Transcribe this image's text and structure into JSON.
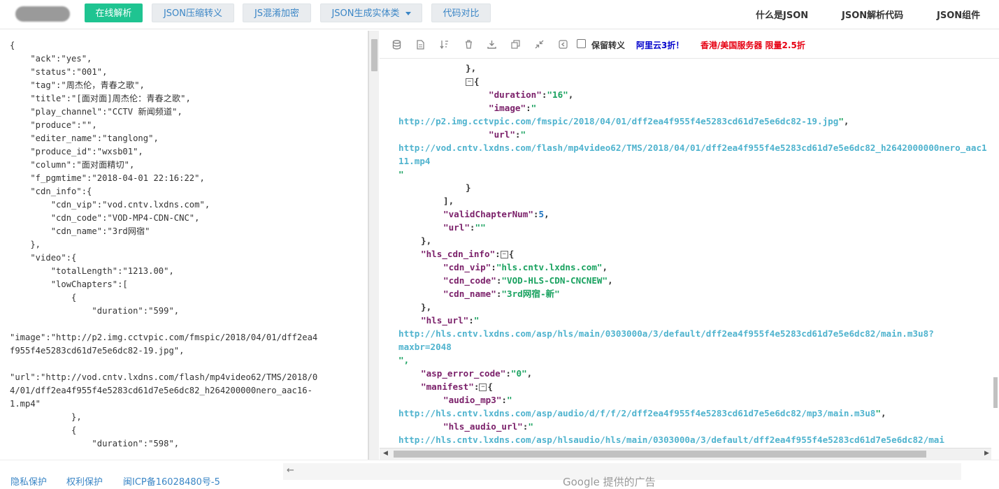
{
  "nav": {
    "buttons": [
      {
        "label": "在线解析"
      },
      {
        "label": "JSON压缩转义"
      },
      {
        "label": "JS混淆加密"
      },
      {
        "label": "JSON生成实体类"
      },
      {
        "label": "代码对比"
      }
    ],
    "right_links": [
      "什么是JSON",
      "JSON解析代码",
      "JSON组件"
    ]
  },
  "left_editor": {
    "text": "{\n    \"ack\":\"yes\",\n    \"status\":\"001\",\n    \"tag\":\"周杰伦，青春之歌\",\n    \"title\":\"[面对面]周杰伦：青春之歌\",\n    \"play_channel\":\"CCTV 新闻频道\",\n    \"produce\":\"\",\n    \"editer_name\":\"tanglong\",\n    \"produce_id\":\"wxsb01\",\n    \"column\":\"面对面精切\",\n    \"f_pgmtime\":\"2018-04-01 22:16:22\",\n    \"cdn_info\":{\n        \"cdn_vip\":\"vod.cntv.lxdns.com\",\n        \"cdn_code\":\"VOD-MP4-CDN-CNC\",\n        \"cdn_name\":\"3rd网宿\"\n    },\n    \"video\":{\n        \"totalLength\":\"1213.00\",\n        \"lowChapters\":[\n            {\n                \"duration\":\"599\",\n\n\"image\":\"http://p2.img.cctvpic.com/fmspic/2018/04/01/dff2ea4\nf955f4e5283cd61d7e5e6dc82-19.jpg\",\n\n\"url\":\"http://vod.cntv.lxdns.com/flash/mp4video62/TMS/2018/0\n4/01/dff2ea4f955f4e5283cd61d7e5e6dc82_h264200000nero_aac16-\n1.mp4\"\n            },\n            {\n                \"duration\":\"598\","
  },
  "toolbar": {
    "icons": [
      "database-icon",
      "file-icon",
      "sort-icon",
      "trash-icon",
      "download-icon",
      "copy-icon",
      "compress-icon",
      "back-icon"
    ],
    "keep_escape_label": "保留转义",
    "ad1": "阿里云3折！",
    "ad2": "香港/美国服务器 限量2.5折",
    "ad1_color": "#0000cc",
    "ad2_color": "#e60012"
  },
  "json_view": {
    "l01": "},",
    "l02_key": "\"duration\"",
    "l02_val": "\"16\"",
    "l03_key": "\"image\"",
    "l03_open": "\"",
    "l04_url": "http://p2.img.cctvpic.com/fmspic/2018/04/01/dff2ea4f955f4e5283cd61d7e5e6dc82-19.jpg",
    "l05_key": "\"url\"",
    "l05_open": "\"",
    "l06_url": "http://vod.cntv.lxdns.com/flash/mp4video62/TMS/2018/04/01/dff2ea4f955f4e5283cd61d7e5e6dc82_h2642000000nero_aac1",
    "l07_url": "11.mp4",
    "l08": "\"",
    "l09": "}",
    "l10": "],",
    "l11_key": "\"validChapterNum\"",
    "l11_val": "5",
    "l12_key": "\"url\"",
    "l12_val": "\"\"",
    "l13": "},",
    "l14_key": "\"hls_cdn_info\"",
    "l15_key": "\"cdn_vip\"",
    "l15_val": "\"hls.cntv.lxdns.com\"",
    "l16_key": "\"cdn_code\"",
    "l16_val": "\"VOD-HLS-CDN-CNCNEW\"",
    "l17_key": "\"cdn_name\"",
    "l17_val": "\"3rd网宿-新\"",
    "l18": "},",
    "l19_key": "\"hls_url\"",
    "l19_open": "\"",
    "l20_url": "http://hls.cntv.lxdns.com/asp/hls/main/0303000a/3/default/dff2ea4f955f4e5283cd61d7e5e6dc82/main.m3u8?",
    "l21_url": "maxbr=2048",
    "l22": "\",",
    "l23_key": "\"asp_error_code\"",
    "l23_val": "\"0\"",
    "l24_key": "\"manifest\"",
    "l25_key": "\"audio_mp3\"",
    "l25_open": "\"",
    "l26_url": "http://hls.cntv.lxdns.com/asp/audio/d/f/f/2/dff2ea4f955f4e5283cd61d7e5e6dc82/mp3/main.m3u8",
    "l27_key": "\"hls_audio_url\"",
    "l27_open": "\"",
    "l28_url": "http://hls.cntv.lxdns.com/asp/hlsaudio/hls/main/0303000a/3/default/dff2ea4f955f4e5283cd61d7e5e6dc82/mai"
  },
  "footer": {
    "links": [
      "隐私保护",
      "权利保护",
      "闽ICP备16028480号-5"
    ],
    "back_arrow": "←",
    "ad_text": "Google 提供的广告"
  }
}
